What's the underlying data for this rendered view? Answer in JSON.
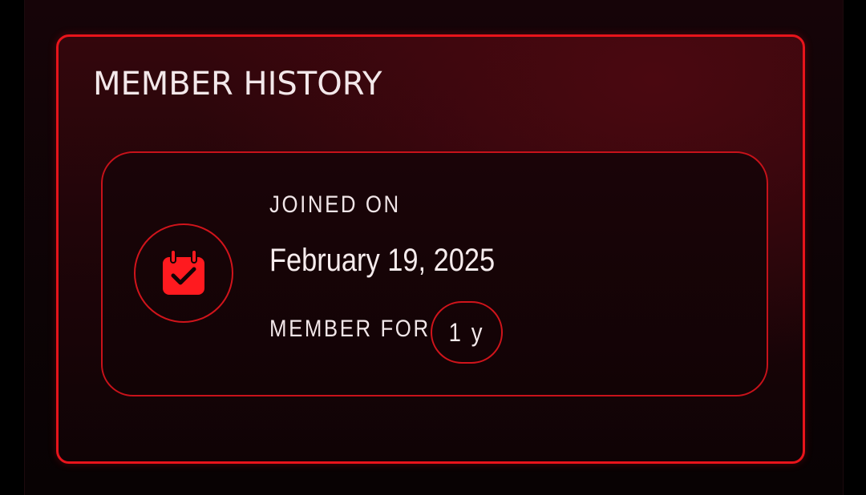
{
  "history": {
    "title": "MEMBER HISTORY",
    "joined_label": "JOINED ON",
    "joined_date": "February 19, 2025",
    "member_for_label": "MEMBER FOR",
    "member_for_value": "1 y",
    "icon": "calendar-check-icon"
  },
  "colors": {
    "accent": "#e8141b",
    "text": "#f3e8ea",
    "background": "#000000"
  }
}
